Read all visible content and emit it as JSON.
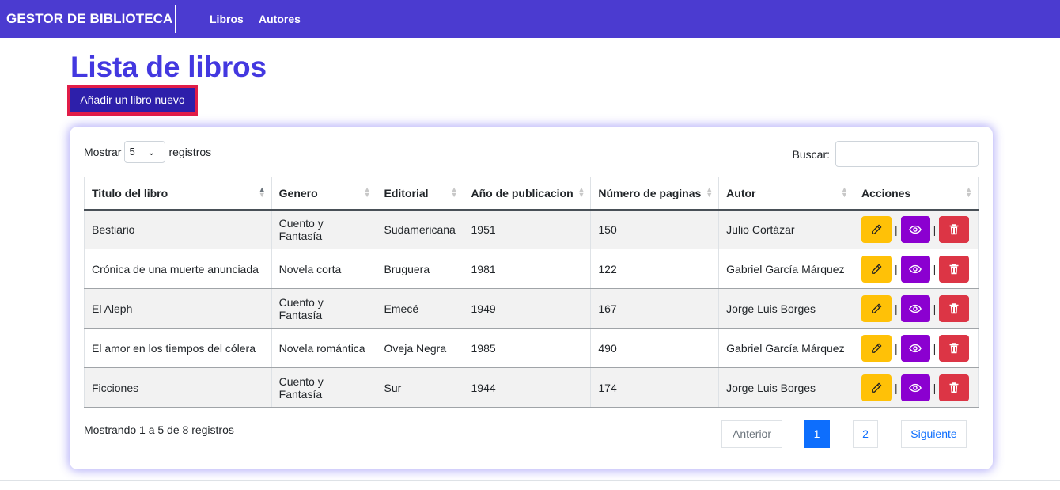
{
  "navbar": {
    "brand": "GESTOR DE BIBLIOTECA",
    "links": [
      "Libros",
      "Autores"
    ],
    "color": "#4b3bd0"
  },
  "page": {
    "title": "Lista de libros",
    "add_button": "Añadir un libro nuevo"
  },
  "table_controls": {
    "show_prefix": "Mostrar",
    "show_value": "5",
    "show_suffix": "registros",
    "search_label": "Buscar:"
  },
  "table": {
    "headers": [
      "Titulo del libro",
      "Genero",
      "Editorial",
      "Año de publicacion",
      "Número de paginas",
      "Autor",
      "Acciones"
    ],
    "rows": [
      [
        "Bestiario",
        "Cuento y Fantasía",
        "Sudamericana",
        "1951",
        "150",
        "Julio Cortázar"
      ],
      [
        "Crónica de una muerte anunciada",
        "Novela corta",
        "Bruguera",
        "1981",
        "122",
        "Gabriel García Márquez"
      ],
      [
        "El Aleph",
        "Cuento y Fantasía",
        "Emecé",
        "1949",
        "167",
        "Jorge Luis Borges"
      ],
      [
        "El amor en los tiempos del cólera",
        "Novela romántica",
        "Oveja Negra",
        "1985",
        "490",
        "Gabriel García Márquez"
      ],
      [
        "Ficciones",
        "Cuento y Fantasía",
        "Sur",
        "1944",
        "174",
        "Jorge Luis Borges"
      ]
    ],
    "action_icons": [
      "pencil-icon",
      "eye-icon",
      "trash-icon"
    ],
    "action_separator": "|"
  },
  "footer": {
    "info": "Mostrando 1 a 5 de 8 registros",
    "prev": "Anterior",
    "pages": [
      "1",
      "2"
    ],
    "next": "Siguiente"
  }
}
